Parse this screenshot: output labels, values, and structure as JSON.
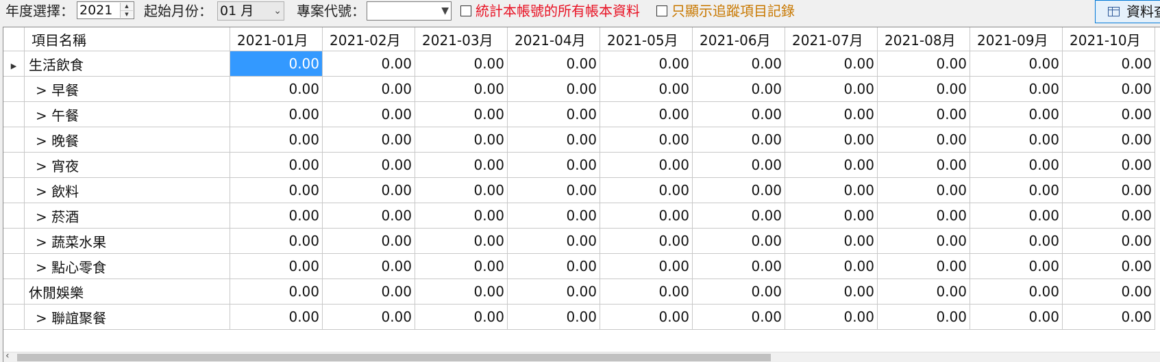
{
  "toolbar": {
    "year_label": "年度選擇：",
    "year_value": "2021",
    "start_month_label": "起始月份：",
    "start_month_value": "01 月",
    "project_label": "專案代號：",
    "project_value": "",
    "check_all_books_label": "統計本帳號的所有帳本資料",
    "check_all_books_checked": false,
    "check_tracked_label": "只顯示追蹤項目記錄",
    "check_tracked_checked": false,
    "query_button_label": "資料查",
    "colors": {
      "all_books_text": "#e81123",
      "tracked_text": "#c87800"
    }
  },
  "grid": {
    "columns": [
      "項目名稱",
      "2021-01月",
      "2021-02月",
      "2021-03月",
      "2021-04月",
      "2021-05月",
      "2021-06月",
      "2021-07月",
      "2021-08月",
      "2021-09月",
      "2021-10月"
    ],
    "rows": [
      {
        "name": "生活飲食",
        "sub": false,
        "current": true,
        "values": [
          "0.00",
          "0.00",
          "0.00",
          "0.00",
          "0.00",
          "0.00",
          "0.00",
          "0.00",
          "0.00",
          "0.00"
        ]
      },
      {
        "name": "> 早餐",
        "sub": true,
        "values": [
          "0.00",
          "0.00",
          "0.00",
          "0.00",
          "0.00",
          "0.00",
          "0.00",
          "0.00",
          "0.00",
          "0.00"
        ]
      },
      {
        "name": "> 午餐",
        "sub": true,
        "values": [
          "0.00",
          "0.00",
          "0.00",
          "0.00",
          "0.00",
          "0.00",
          "0.00",
          "0.00",
          "0.00",
          "0.00"
        ]
      },
      {
        "name": "> 晚餐",
        "sub": true,
        "values": [
          "0.00",
          "0.00",
          "0.00",
          "0.00",
          "0.00",
          "0.00",
          "0.00",
          "0.00",
          "0.00",
          "0.00"
        ]
      },
      {
        "name": "> 宵夜",
        "sub": true,
        "values": [
          "0.00",
          "0.00",
          "0.00",
          "0.00",
          "0.00",
          "0.00",
          "0.00",
          "0.00",
          "0.00",
          "0.00"
        ]
      },
      {
        "name": "> 飲料",
        "sub": true,
        "values": [
          "0.00",
          "0.00",
          "0.00",
          "0.00",
          "0.00",
          "0.00",
          "0.00",
          "0.00",
          "0.00",
          "0.00"
        ]
      },
      {
        "name": "> 菸酒",
        "sub": true,
        "values": [
          "0.00",
          "0.00",
          "0.00",
          "0.00",
          "0.00",
          "0.00",
          "0.00",
          "0.00",
          "0.00",
          "0.00"
        ]
      },
      {
        "name": "> 蔬菜水果",
        "sub": true,
        "values": [
          "0.00",
          "0.00",
          "0.00",
          "0.00",
          "0.00",
          "0.00",
          "0.00",
          "0.00",
          "0.00",
          "0.00"
        ]
      },
      {
        "name": "> 點心零食",
        "sub": true,
        "values": [
          "0.00",
          "0.00",
          "0.00",
          "0.00",
          "0.00",
          "0.00",
          "0.00",
          "0.00",
          "0.00",
          "0.00"
        ]
      },
      {
        "name": "休閒娛樂",
        "sub": false,
        "values": [
          "0.00",
          "0.00",
          "0.00",
          "0.00",
          "0.00",
          "0.00",
          "0.00",
          "0.00",
          "0.00",
          "0.00"
        ]
      },
      {
        "name": "> 聯誼聚餐",
        "sub": true,
        "values": [
          "0.00",
          "0.00",
          "0.00",
          "0.00",
          "0.00",
          "0.00",
          "0.00",
          "0.00",
          "0.00",
          "0.00"
        ]
      }
    ],
    "selected_cell": {
      "row": 0,
      "col": 0
    }
  }
}
